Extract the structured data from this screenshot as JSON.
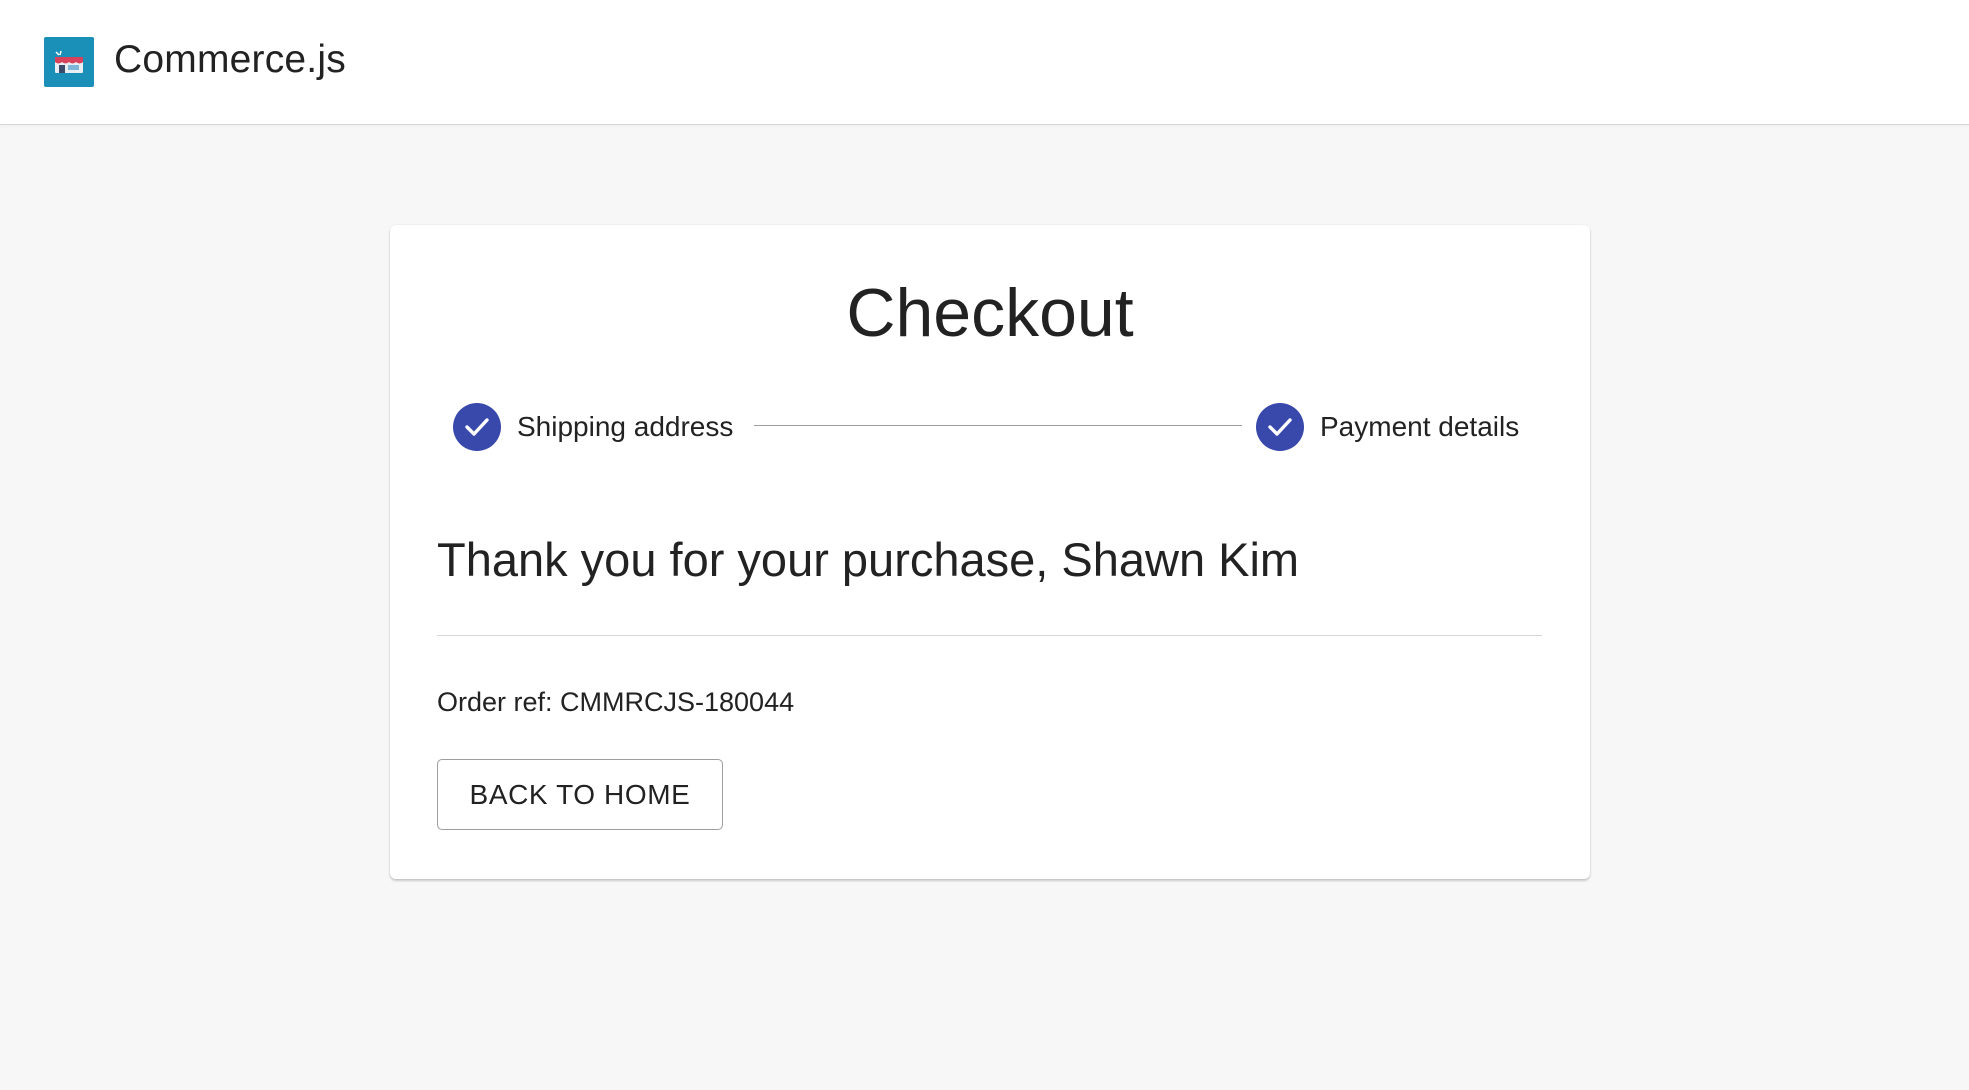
{
  "header": {
    "brand": "Commerce.js",
    "logo_icon": "store-icon",
    "logo_color": "#1a8fb8"
  },
  "checkout": {
    "title": "Checkout",
    "steps": [
      {
        "label": "Shipping address",
        "status": "completed",
        "icon": "check-icon"
      },
      {
        "label": "Payment details",
        "status": "completed",
        "icon": "check-icon"
      }
    ],
    "step_color": "#3949ab",
    "thank_you": "Thank you for your purchase, Shawn Kim",
    "order_ref": "Order ref: CMMRCJS-180044",
    "back_button_label": "BACK TO HOME"
  }
}
